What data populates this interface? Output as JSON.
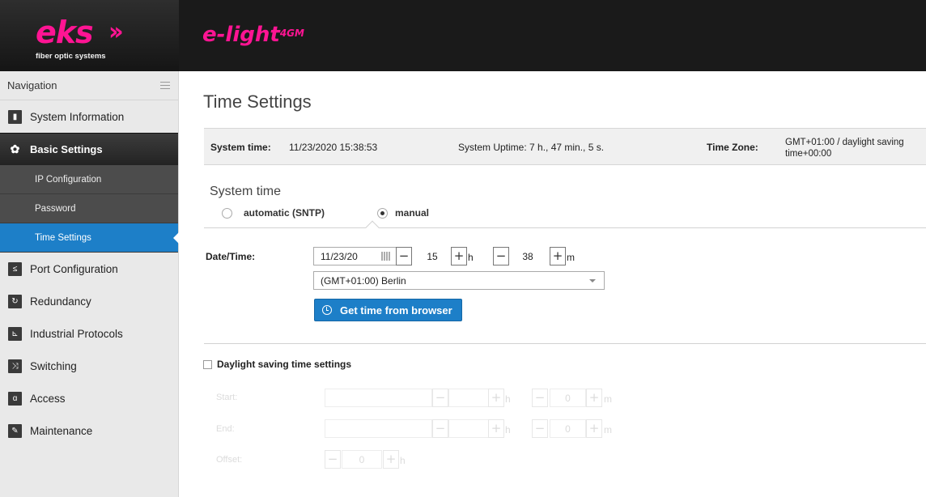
{
  "header": {
    "company_logo": "eks",
    "company_tagline": "fiber optic systems",
    "product_name": "e-light",
    "product_suffix": "4GM"
  },
  "sidebar": {
    "title": "Navigation",
    "items": [
      {
        "label": "System Information",
        "icon": "chart-icon"
      },
      {
        "label": "Basic Settings",
        "icon": "gear-icon",
        "active": true,
        "children": [
          {
            "label": "IP Configuration"
          },
          {
            "label": "Password"
          },
          {
            "label": "Time Settings",
            "selected": true
          }
        ]
      },
      {
        "label": "Port Configuration",
        "icon": "port-icon"
      },
      {
        "label": "Redundancy",
        "icon": "redundancy-icon"
      },
      {
        "label": "Industrial Protocols",
        "icon": "protocol-icon"
      },
      {
        "label": "Switching",
        "icon": "switching-icon"
      },
      {
        "label": "Access",
        "icon": "lock-icon"
      },
      {
        "label": "Maintenance",
        "icon": "wrench-icon"
      }
    ]
  },
  "page": {
    "title": "Time Settings",
    "info": {
      "system_time_label": "System time:",
      "system_time_value": "11/23/2020 15:38:53",
      "uptime": "System Uptime: 7 h., 47 min., 5 s.",
      "timezone_label": "Time Zone:",
      "timezone_value": "GMT+01:00 / daylight saving time+00:00"
    },
    "system_time_section": {
      "title": "System time",
      "mode_automatic": "automatic (SNTP)",
      "mode_manual": "manual",
      "selected_mode": "manual"
    },
    "datetime": {
      "label": "Date/Time:",
      "date": "11/23/20",
      "hour": "15",
      "hour_unit": "h",
      "minute": "38",
      "minute_unit": "m",
      "timezone_select": "(GMT+01:00) Berlin",
      "browser_button": "Get time from browser"
    },
    "dst": {
      "checkbox_label": "Daylight saving time settings",
      "checked": false,
      "start_label": "Start:",
      "end_label": "End:",
      "offset_label": "Offset:",
      "start_minute": "0",
      "end_minute": "0",
      "offset": "0",
      "hour_unit": "h",
      "minute_unit": "m"
    }
  },
  "colors": {
    "brand_pink": "#ff1493",
    "accent_blue": "#1d7fc8"
  }
}
